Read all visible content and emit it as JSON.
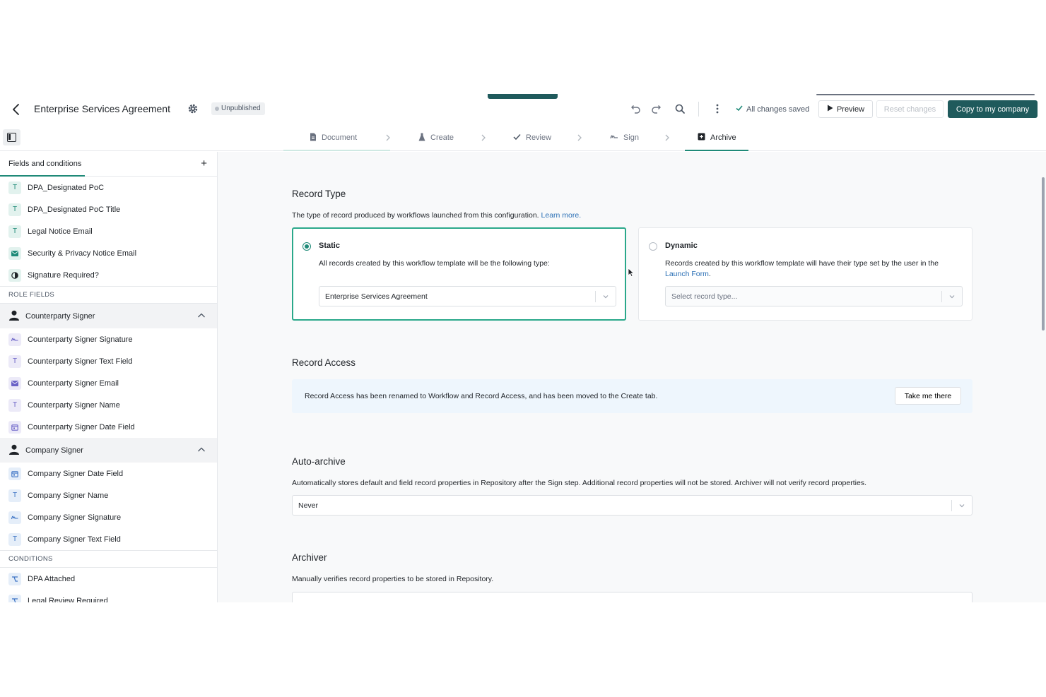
{
  "header": {
    "title": "Enterprise Services Agreement",
    "status": "Unpublished",
    "saved_text": "All changes saved",
    "preview_label": "Preview",
    "reset_label": "Reset changes",
    "copy_label": "Copy to my company"
  },
  "tabs": [
    {
      "label": "Document",
      "icon": "document-icon"
    },
    {
      "label": "Create",
      "icon": "flask-icon"
    },
    {
      "label": "Review",
      "icon": "check-icon"
    },
    {
      "label": "Sign",
      "icon": "signature-icon"
    },
    {
      "label": "Archive",
      "icon": "archive-icon",
      "active": true
    }
  ],
  "sidebar": {
    "heading": "Fields and conditions",
    "fields": [
      {
        "label": "DPA_Designated PoC",
        "icon": "T"
      },
      {
        "label": "DPA_Designated PoC Title",
        "icon": "T"
      },
      {
        "label": "Legal Notice Email",
        "icon": "T"
      },
      {
        "label": "Security & Privacy Notice Email",
        "icon": "email"
      },
      {
        "label": "Signature Required?",
        "icon": "toggle"
      }
    ],
    "role_fields_label": "ROLE FIELDS",
    "roles": [
      {
        "name": "Counterparty Signer",
        "items": [
          {
            "label": "Counterparty Signer Signature",
            "icon": "signature"
          },
          {
            "label": "Counterparty Signer Text Field",
            "icon": "T"
          },
          {
            "label": "Counterparty Signer Email",
            "icon": "email"
          },
          {
            "label": "Counterparty Signer Name",
            "icon": "T"
          },
          {
            "label": "Counterparty Signer Date Field",
            "icon": "date"
          }
        ]
      },
      {
        "name": "Company Signer",
        "items": [
          {
            "label": "Company Signer Date Field",
            "icon": "date"
          },
          {
            "label": "Company Signer Name",
            "icon": "T"
          },
          {
            "label": "Company Signer Signature",
            "icon": "signature"
          },
          {
            "label": "Company Signer Text Field",
            "icon": "T"
          }
        ]
      }
    ],
    "conditions_label": "CONDITIONS",
    "conditions": [
      {
        "label": "DPA Attached"
      },
      {
        "label": "Legal Review Required"
      }
    ]
  },
  "record_type": {
    "title": "Record Type",
    "description": "The type of record produced by workflows launched from this configuration.",
    "learn_more": "Learn more.",
    "static": {
      "title": "Static",
      "description": "All records created by this workflow template will be the following type:",
      "value": "Enterprise Services Agreement"
    },
    "dynamic": {
      "title": "Dynamic",
      "description": "Records created by this workflow template will have their type set by the user in the",
      "link": "Launch Form",
      "placeholder": "Select record type..."
    }
  },
  "record_access": {
    "title": "Record Access",
    "banner_text": "Record Access has been renamed to Workflow and Record Access, and has been moved to the Create tab.",
    "banner_button": "Take me there"
  },
  "auto_archive": {
    "title": "Auto-archive",
    "description": "Automatically stores default and field record properties in Repository after the Sign step. Additional record properties will not be stored. Archiver will not verify record properties.",
    "value": "Never"
  },
  "archiver": {
    "title": "Archiver",
    "description": "Manually verifies record properties to be stored in Repository."
  }
}
